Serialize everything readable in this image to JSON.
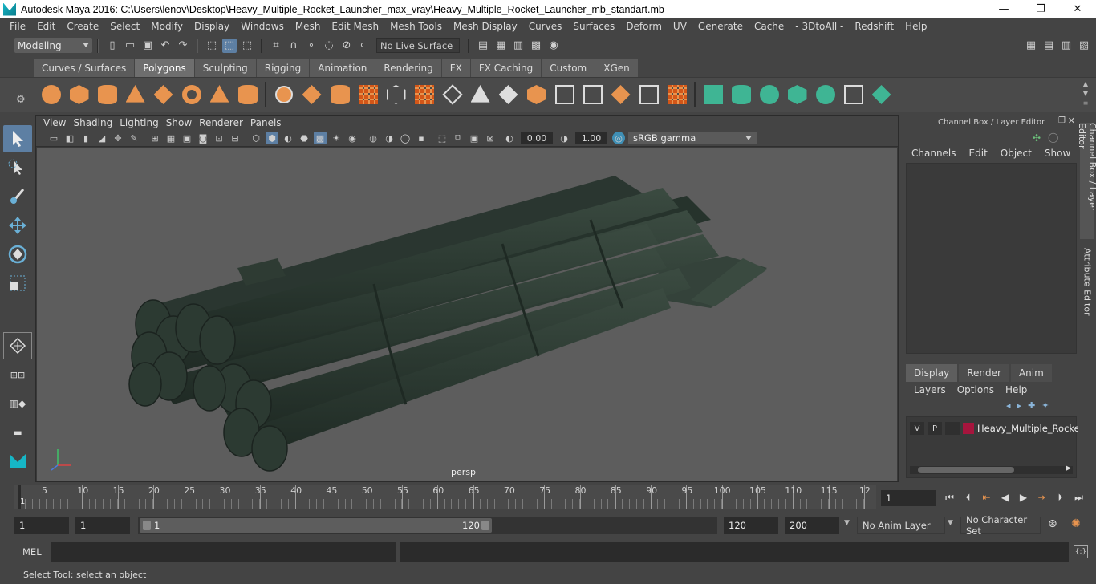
{
  "window": {
    "title": "Autodesk Maya 2016: C:\\Users\\lenov\\Desktop\\Heavy_Multiple_Rocket_Launcher_max_vray\\Heavy_Multiple_Rocket_Launcher_mb_standart.mb",
    "minimize": "—",
    "restore": "❐",
    "close": "✕"
  },
  "menu": [
    "File",
    "Edit",
    "Create",
    "Select",
    "Modify",
    "Display",
    "Windows",
    "Mesh",
    "Edit Mesh",
    "Mesh Tools",
    "Mesh Display",
    "Curves",
    "Surfaces",
    "Deform",
    "UV",
    "Generate",
    "Cache",
    "- 3DtoAll -",
    "Redshift",
    "Help"
  ],
  "statusline": {
    "mode": "Modeling",
    "live_surface": "No Live Surface"
  },
  "shelf_tabs": [
    {
      "label": "Curves / Surfaces",
      "active": false
    },
    {
      "label": "Polygons",
      "active": true
    },
    {
      "label": "Sculpting",
      "active": false
    },
    {
      "label": "Rigging",
      "active": false
    },
    {
      "label": "Animation",
      "active": false
    },
    {
      "label": "Rendering",
      "active": false
    },
    {
      "label": "FX",
      "active": false
    },
    {
      "label": "FX Caching",
      "active": false
    },
    {
      "label": "Custom",
      "active": false
    },
    {
      "label": "XGen",
      "active": false
    }
  ],
  "panel": {
    "menu": [
      "View",
      "Shading",
      "Lighting",
      "Show",
      "Renderer",
      "Panels"
    ],
    "exposure": "0.00",
    "gamma_value": "1.00",
    "color_space": "sRGB gamma",
    "camera_label": "persp"
  },
  "channel_box": {
    "title": "Channel Box / Layer Editor",
    "menu": [
      "Channels",
      "Edit",
      "Object",
      "Show"
    ]
  },
  "layer_editor": {
    "tabs": [
      {
        "label": "Display",
        "active": true
      },
      {
        "label": "Render",
        "active": false
      },
      {
        "label": "Anim",
        "active": false
      }
    ],
    "menu": [
      "Layers",
      "Options",
      "Help"
    ],
    "layer": {
      "v": "V",
      "p": "P",
      "name": "Heavy_Multiple_Rocke",
      "color": "#a6153d"
    }
  },
  "side_tabs": [
    "Channel Box / Layer Editor",
    "Attribute Editor"
  ],
  "timeline": {
    "labels": [
      "5",
      "10",
      "15",
      "20",
      "25",
      "30",
      "35",
      "40",
      "45",
      "50",
      "55",
      "60",
      "65",
      "70",
      "75",
      "80",
      "85",
      "90",
      "95",
      "100",
      "105",
      "110",
      "115",
      "12"
    ],
    "current_frame_label": "1",
    "current_frame": "1"
  },
  "range": {
    "start": "1",
    "playback_start": "1",
    "slider_start": "1",
    "slider_end": "120",
    "playback_end": "120",
    "end": "200",
    "anim_layer": "No Anim Layer",
    "character_set": "No Character Set"
  },
  "command_line": {
    "label": "MEL"
  },
  "help_line": "Select Tool: select an object",
  "colors": {
    "accent": "#5d7fa3",
    "shelf_orange": "#e8944f",
    "shelf_green": "#3fb594",
    "model_green": "#2f3d35"
  }
}
